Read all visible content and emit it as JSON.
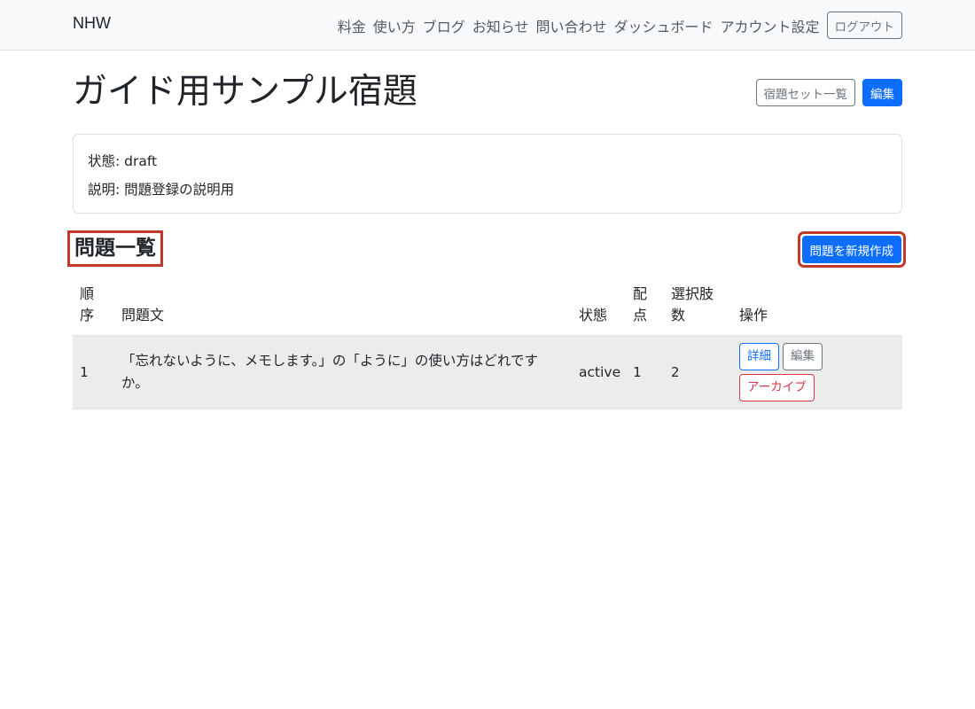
{
  "navbar": {
    "brand": "NHW",
    "links": [
      "料金",
      "使い方",
      "ブログ",
      "お知らせ",
      "問い合わせ",
      "ダッシュボード",
      "アカウント設定"
    ],
    "logout_label": "ログアウト"
  },
  "page": {
    "title": "ガイド用サンプル宿題",
    "list_button": "宿題セット一覧",
    "edit_button": "編集"
  },
  "info": {
    "status_line": "状態: draft",
    "description_line": "説明: 問題登録の説明用"
  },
  "questions": {
    "section_title": "問題一覧",
    "new_button": "問題を新規作成",
    "columns": {
      "order": "順序",
      "text": "問題文",
      "status": "状態",
      "points": "配点",
      "choices": "選択肢数",
      "actions": "操作"
    },
    "rows": [
      {
        "order": "1",
        "text": "「忘れないように、メモします。」の「ように」の使い方はどれですか。",
        "status": "active",
        "points": "1",
        "choices": "2",
        "detail_label": "詳細",
        "edit_label": "編集",
        "archive_label": "アーカイブ"
      }
    ]
  },
  "colors": {
    "primary": "#0d6efd",
    "secondary": "#6c757d",
    "danger": "#dc3545",
    "highlight": "#c0392b"
  }
}
